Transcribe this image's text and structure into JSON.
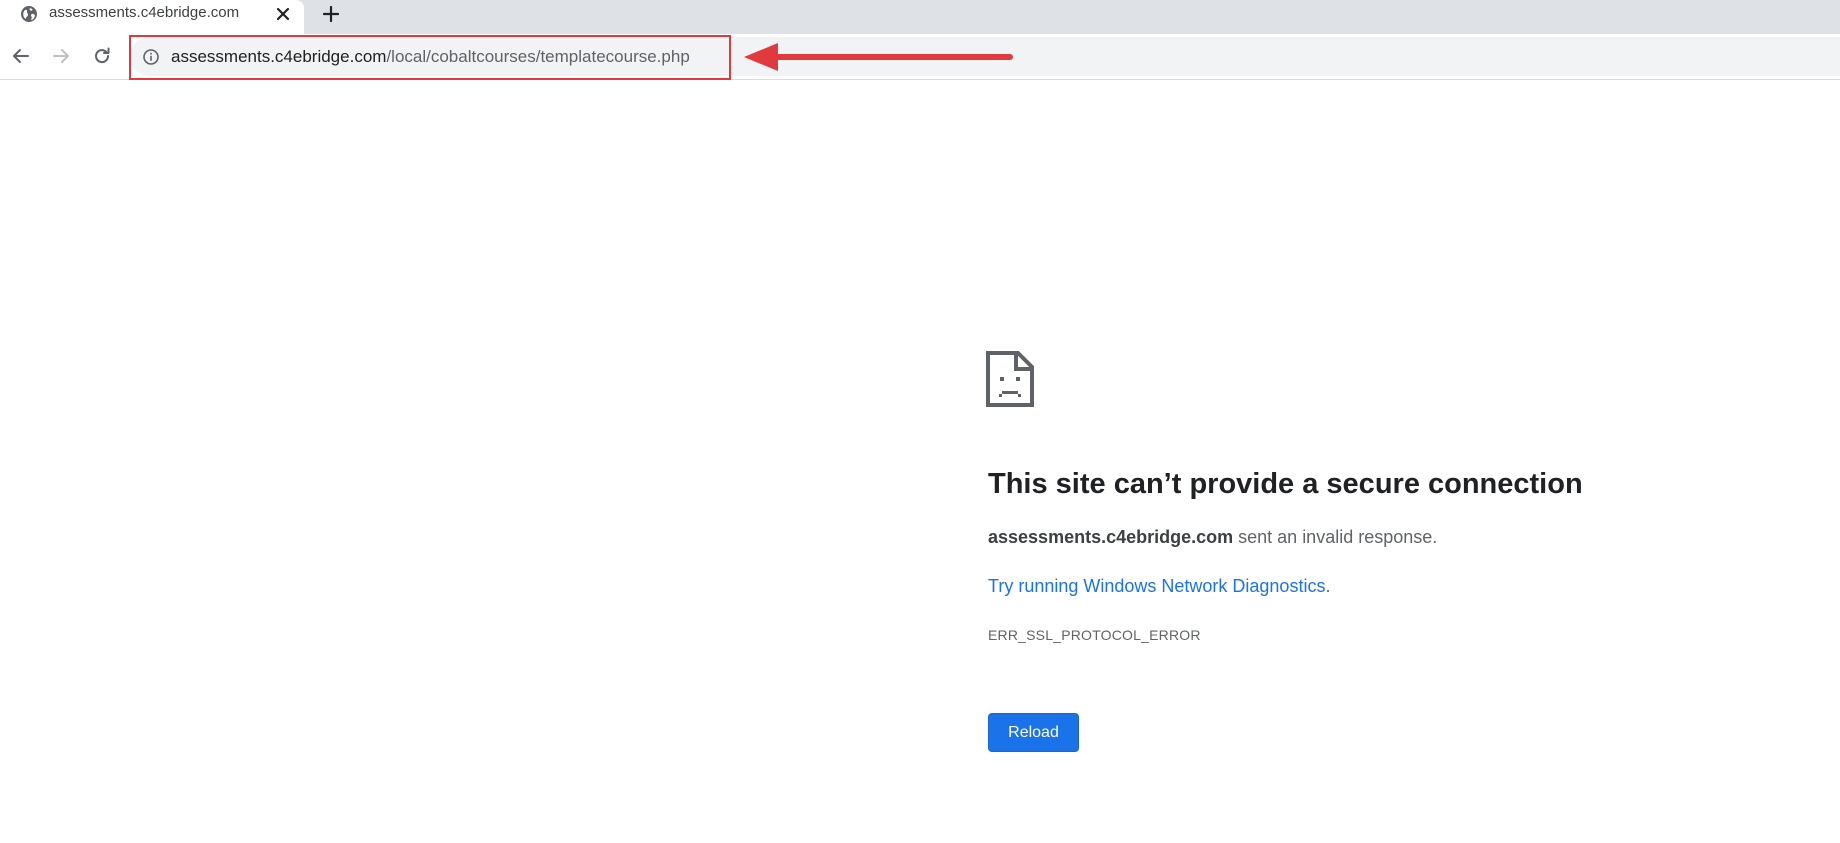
{
  "tab": {
    "title": "assessments.c4ebridge.com",
    "favicon": "globe-icon",
    "close": "close-icon"
  },
  "new_tab": "plus-icon",
  "toolbar": {
    "back": "back-arrow-icon",
    "forward": "forward-arrow-icon",
    "reload": "reload-icon"
  },
  "omnibox": {
    "icon": "info-icon",
    "url_host": "assessments.c4ebridge.com",
    "url_path": "/local/cobaltcourses/templatecourse.php"
  },
  "annotation": {
    "color": "#e0393e"
  },
  "error": {
    "icon": "sad-document-icon",
    "title": "This site can’t provide a secure connection",
    "description_host": "assessments.c4ebridge.com",
    "description_text": " sent an invalid response.",
    "suggestion_link": "Try running Windows Network Diagnostics",
    "suggestion_end": ".",
    "code": "ERR_SSL_PROTOCOL_ERROR",
    "reload_label": "Reload"
  },
  "colors": {
    "accent": "#1a73e8",
    "tabstrip": "#dee1e6",
    "omnibox": "#f1f3f4"
  }
}
